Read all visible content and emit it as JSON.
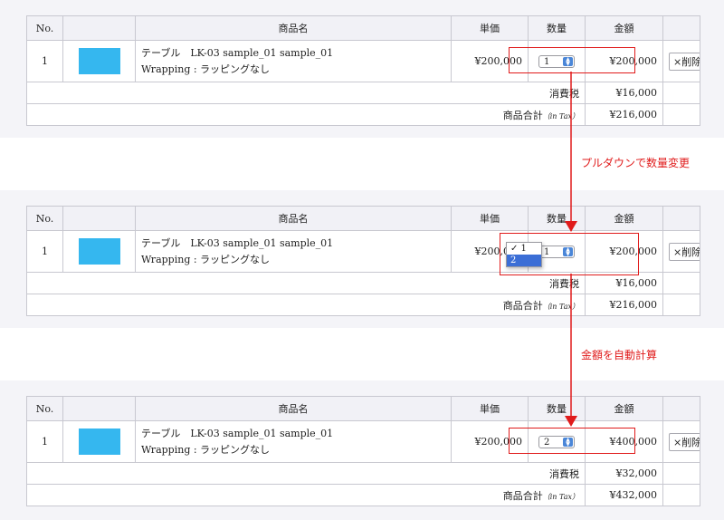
{
  "header": {
    "no": "No.",
    "name": "商品名",
    "unit_price": "単価",
    "quantity": "数量",
    "amount": "金額"
  },
  "panels": [
    {
      "row_no": "1",
      "product_title": "テーブル　LK-03 sample_01 sample_01",
      "wrapping": "Wrapping : ラッピングなし",
      "unit_price": "¥200,000",
      "quantity": "1",
      "amount": "¥200,000",
      "delete_label": "×削除",
      "tax_label": "消費税",
      "tax_value": "¥16,000",
      "total_label": "商品合計",
      "intax": "（in Tax）",
      "total_value": "¥216,000"
    },
    {
      "row_no": "1",
      "product_title": "テーブル　LK-03 sample_01 sample_01",
      "wrapping": "Wrapping : ラッピングなし",
      "unit_price": "¥200,000",
      "quantity": "1",
      "amount": "¥200,000",
      "delete_label": "×削除",
      "tax_label": "消費税",
      "tax_value": "¥16,000",
      "total_label": "商品合計",
      "intax": "（in Tax）",
      "total_value": "¥216,000",
      "dropdown_options": [
        "✓ 1",
        "2"
      ],
      "dropdown_highlighted": "2"
    },
    {
      "row_no": "1",
      "product_title": "テーブル　LK-03 sample_01 sample_01",
      "wrapping": "Wrapping : ラッピングなし",
      "unit_price": "¥200,000",
      "quantity": "2",
      "amount": "¥400,000",
      "delete_label": "×削除",
      "tax_label": "消費税",
      "tax_value": "¥32,000",
      "total_label": "商品合計",
      "intax": "（in Tax）",
      "total_value": "¥432,000"
    }
  ],
  "annotations": {
    "step1": "プルダウンで数量変更",
    "step2": "金額を自動計算",
    "color": "#e01b1b"
  },
  "colors": {
    "thumbnail": "#35b7ef",
    "band": "#f4f4f8",
    "dropdown_highlight": "#3b6ed6"
  }
}
